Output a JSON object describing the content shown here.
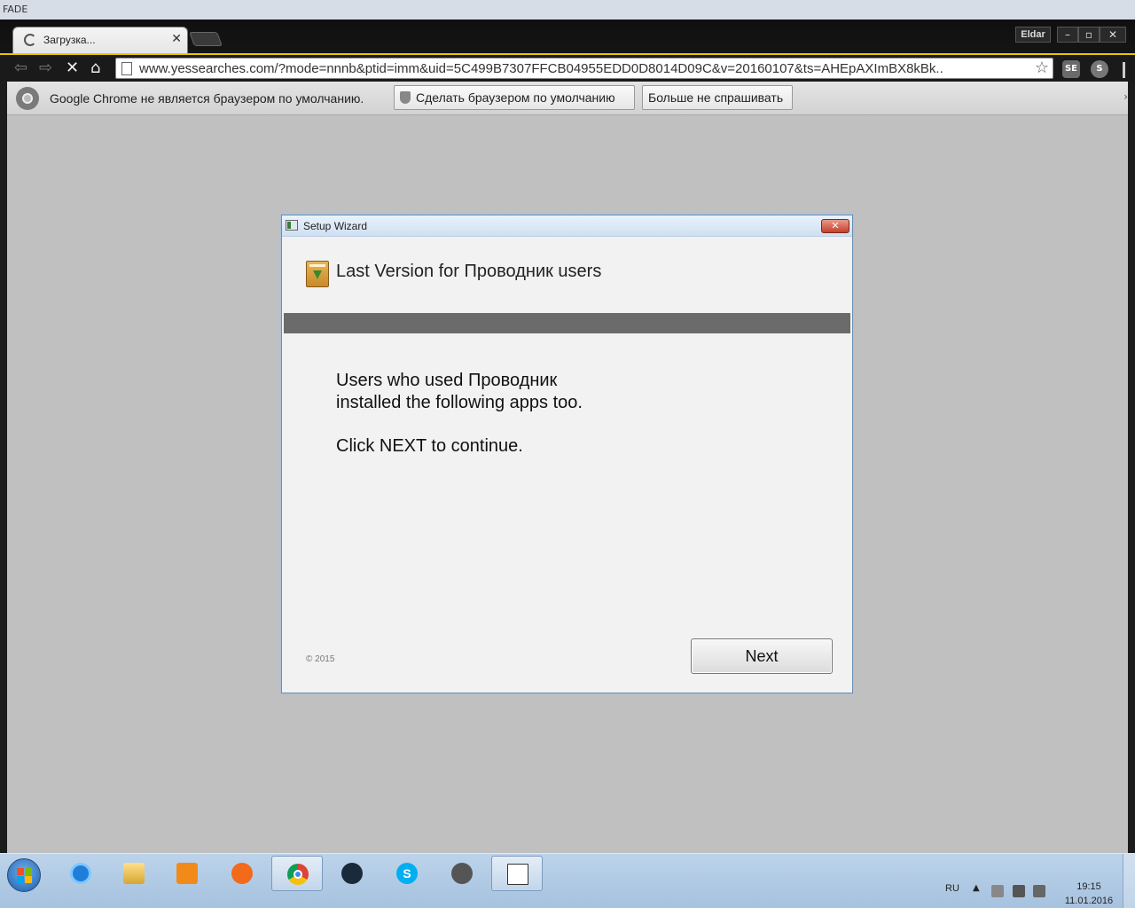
{
  "desktop": {
    "top_label": "FADE"
  },
  "browser": {
    "tab": {
      "title": "Загрузка..."
    },
    "profile": "Eldar",
    "address": {
      "url": "www.yessearches.com/?mode=nnnb&ptid=imm&uid=5C499B7307FFCB04955EDD0D8014D09C&v=20160107&ts=AHEpAXImBX8kBk.."
    },
    "infobar": {
      "message": "Google Chrome не является браузером по умолчанию.",
      "set_default_label": "Сделать браузером по умолчанию",
      "dont_ask_label": "Больше не спрашивать"
    }
  },
  "dialog": {
    "window_title": "Setup Wizard",
    "header": "Last Version for Проводник users",
    "body_line1": "Users who used Проводник",
    "body_line2": "installed the following apps too.",
    "body_line3": "Click NEXT to continue.",
    "copyright": "© 2015",
    "next_label": "Next"
  },
  "taskbar": {
    "language": "RU",
    "time": "19:15",
    "date": "11.01.2016"
  }
}
